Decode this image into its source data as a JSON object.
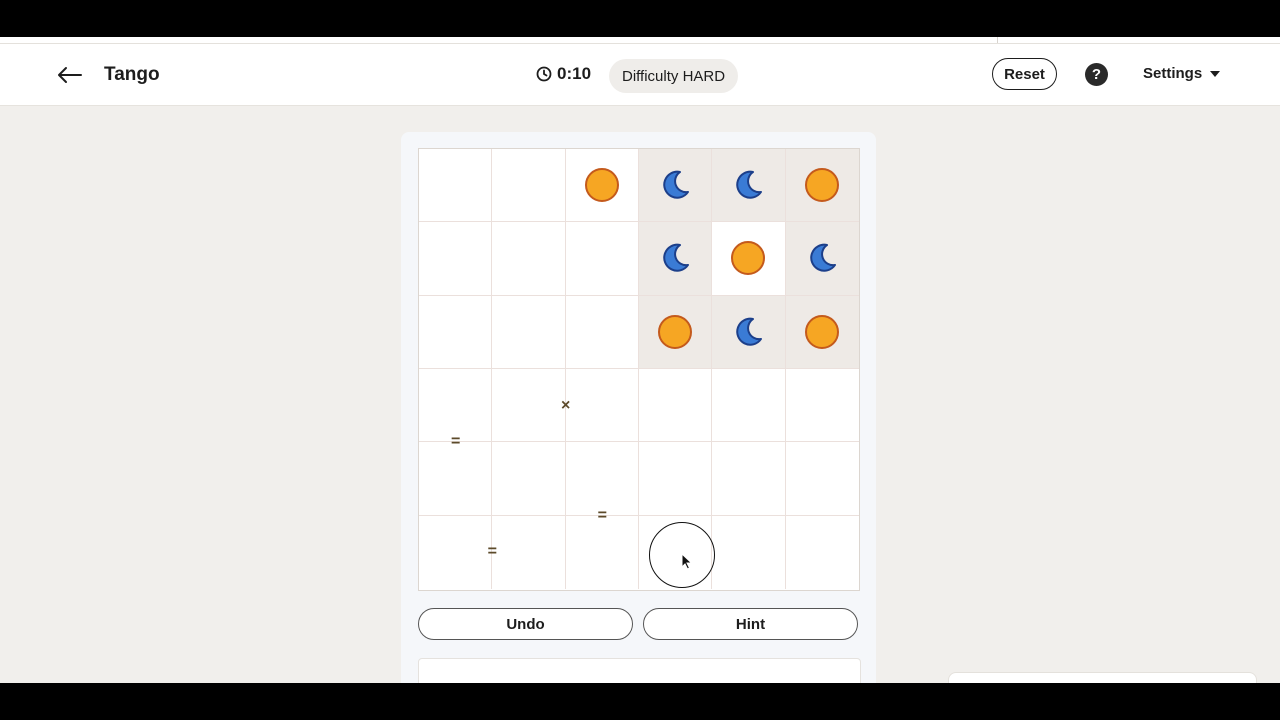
{
  "header": {
    "title": "Tango",
    "timer": "0:10",
    "difficulty": "Difficulty HARD",
    "reset_label": "Reset",
    "help_label": "?",
    "settings_label": "Settings"
  },
  "board": {
    "size": 6,
    "cells": [
      [
        "empty",
        "empty",
        "sun",
        "moon",
        "moon",
        "sun"
      ],
      [
        "empty",
        "empty",
        "empty",
        "moon",
        "sun",
        "moon"
      ],
      [
        "empty",
        "empty",
        "empty",
        "sun",
        "moon",
        "sun"
      ],
      [
        "empty",
        "empty",
        "empty",
        "empty",
        "empty",
        "empty"
      ],
      [
        "empty",
        "empty",
        "empty",
        "empty",
        "empty",
        "empty"
      ],
      [
        "empty",
        "empty",
        "empty",
        "empty",
        "empty",
        "empty"
      ]
    ],
    "shaded": [
      [
        false,
        false,
        false,
        true,
        true,
        true
      ],
      [
        false,
        false,
        false,
        true,
        false,
        true
      ],
      [
        false,
        false,
        false,
        true,
        true,
        true
      ],
      [
        false,
        false,
        false,
        false,
        false,
        false
      ],
      [
        false,
        false,
        false,
        false,
        false,
        false
      ],
      [
        false,
        false,
        false,
        false,
        false,
        false
      ]
    ],
    "constraints": [
      {
        "type": "×",
        "row": 3,
        "col": 1,
        "side": "right"
      },
      {
        "type": "=",
        "row": 3,
        "col": 0,
        "side": "bottom"
      },
      {
        "type": "=",
        "row": 4,
        "col": 2,
        "side": "bottom"
      },
      {
        "type": "=",
        "row": 5,
        "col": 0,
        "side": "right"
      }
    ],
    "colors": {
      "sun_fill": "#f6a623",
      "sun_stroke": "#c45a1c",
      "moon_fill": "#3a7bd5",
      "moon_stroke": "#1c3f8a"
    }
  },
  "controls": {
    "undo_label": "Undo",
    "hint_label": "Hint"
  }
}
